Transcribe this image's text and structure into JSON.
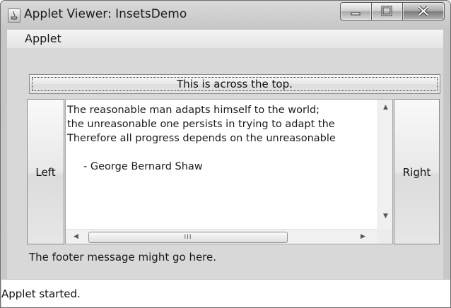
{
  "window": {
    "title": "Applet Viewer: InsetsDemo"
  },
  "menubar": {
    "items": [
      {
        "label": "Applet"
      }
    ]
  },
  "applet": {
    "top_button": "This is across the top.",
    "left_button": "Left",
    "right_button": "Right",
    "textarea_lines": [
      "The reasonable man adapts himself to the world;",
      "the unreasonable one persists in trying to adapt the",
      "Therefore all progress depends on the unreasonable",
      "",
      "     - George Bernard Shaw"
    ],
    "hscroll_grip": "III",
    "footer": "The footer message might go here."
  },
  "status": {
    "text": "Applet started."
  }
}
